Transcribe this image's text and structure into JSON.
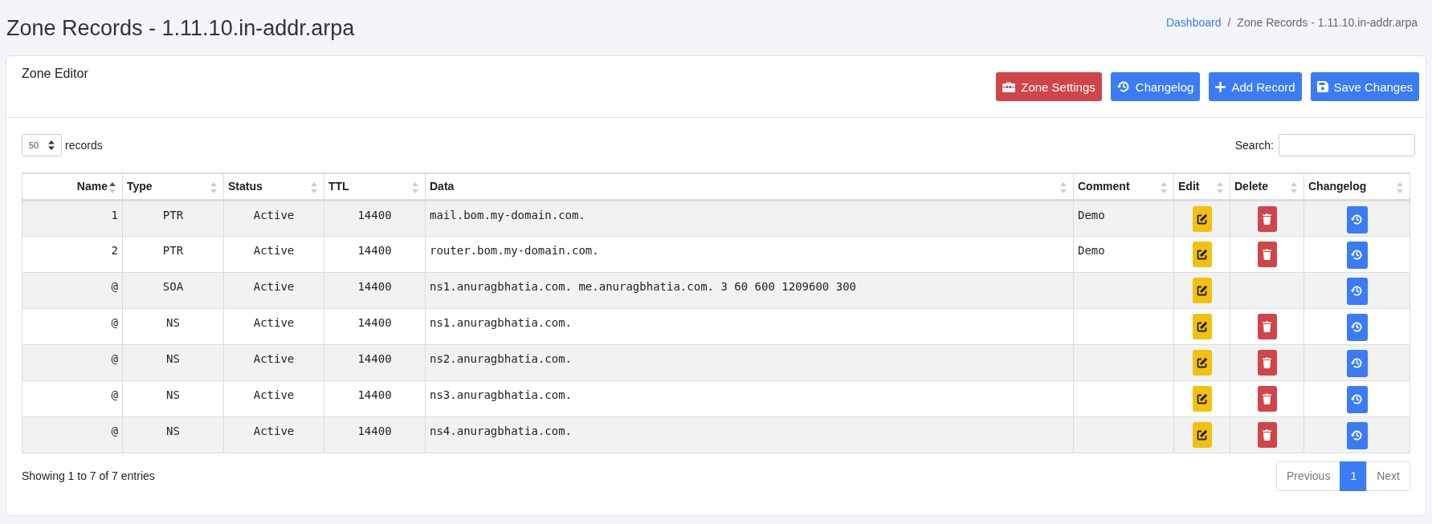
{
  "page_title": "Zone Records - 1.11.10.in-addr.arpa",
  "breadcrumb": [
    "Dashboard",
    "Zone Records - 1.11.10.in-addr.arpa"
  ],
  "breadcrumb_separator": "/",
  "card": {
    "title": "Zone Editor",
    "buttons": [
      {
        "label": "Zone Settings",
        "kind": "settings"
      },
      {
        "label": "Changelog",
        "kind": "changelog"
      },
      {
        "label": "Add Record",
        "kind": "add"
      },
      {
        "label": "Save Changes",
        "kind": "save"
      }
    ]
  },
  "length_select": {
    "value": "50",
    "label": "records"
  },
  "search": {
    "label": "Search:"
  },
  "table": {
    "columns": [
      {
        "label": "Name",
        "sorted": true
      },
      {
        "label": "Type",
        "sorted": false
      },
      {
        "label": "Status",
        "sorted": false
      },
      {
        "label": "TTL",
        "sorted": false
      },
      {
        "label": "Data",
        "sorted": false
      },
      {
        "label": "Comment",
        "sorted": false
      },
      {
        "label": "Edit",
        "sorted": false
      },
      {
        "label": "Delete",
        "sorted": false
      },
      {
        "label": "Changelog",
        "sorted": false
      }
    ],
    "rows": [
      {
        "name": "1",
        "type": "PTR",
        "status": "Active",
        "ttl": "14400",
        "data": "mail.bom.my-domain.com.",
        "comment": "Demo",
        "deletable": true
      },
      {
        "name": "2",
        "type": "PTR",
        "status": "Active",
        "ttl": "14400",
        "data": "router.bom.my-domain.com.",
        "comment": "Demo",
        "deletable": true
      },
      {
        "name": "@",
        "type": "SOA",
        "status": "Active",
        "ttl": "14400",
        "data": "ns1.anuragbhatia.com. me.anuragbhatia.com. 3 60 600 1209600 300",
        "comment": "",
        "deletable": false
      },
      {
        "name": "@",
        "type": "NS",
        "status": "Active",
        "ttl": "14400",
        "data": "ns1.anuragbhatia.com.",
        "comment": "",
        "deletable": true
      },
      {
        "name": "@",
        "type": "NS",
        "status": "Active",
        "ttl": "14400",
        "data": "ns2.anuragbhatia.com.",
        "comment": "",
        "deletable": true
      },
      {
        "name": "@",
        "type": "NS",
        "status": "Active",
        "ttl": "14400",
        "data": "ns3.anuragbhatia.com.",
        "comment": "",
        "deletable": true
      },
      {
        "name": "@",
        "type": "NS",
        "status": "Active",
        "ttl": "14400",
        "data": "ns4.anuragbhatia.com.",
        "comment": "",
        "deletable": true
      }
    ]
  },
  "info": "Showing 1 to 7 of 7 entries",
  "pagination": [
    {
      "label": "Previous",
      "selected": false,
      "disabled": true
    },
    {
      "label": "1",
      "selected": true,
      "disabled": false
    },
    {
      "label": "Next",
      "selected": false,
      "disabled": true
    }
  ]
}
